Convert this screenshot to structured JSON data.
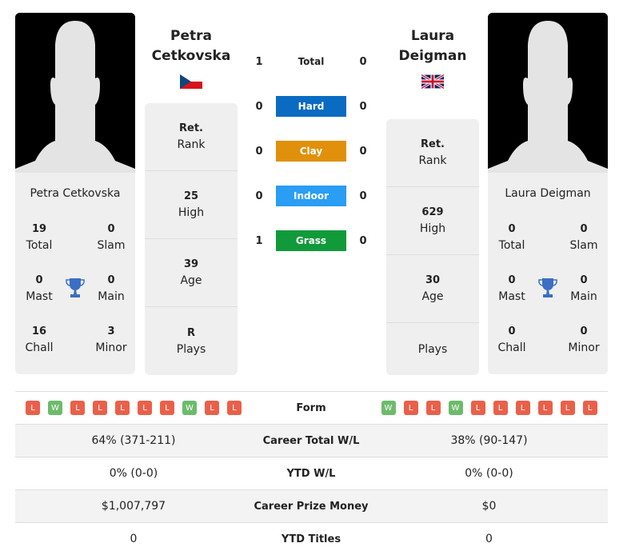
{
  "player1": {
    "name_line1": "Petra",
    "name_line2": "Cetkovska",
    "full_name": "Petra Cetkovska",
    "flag": "czech-republic-flag",
    "titles": {
      "total": "19",
      "slam": "0",
      "mast": "0",
      "main": "0",
      "chall": "16",
      "minor": "3"
    },
    "rank": {
      "value": "Ret.",
      "label": "Rank"
    },
    "high": {
      "value": "25",
      "label": "High"
    },
    "age": {
      "value": "39",
      "label": "Age"
    },
    "plays": {
      "value": "R",
      "label": "Plays"
    },
    "form": [
      "L",
      "W",
      "L",
      "L",
      "L",
      "L",
      "L",
      "W",
      "L",
      "L"
    ],
    "career_wl": "64% (371-211)",
    "ytd_wl": "0% (0-0)",
    "prize": "$1,007,797",
    "ytd_titles": "0"
  },
  "player2": {
    "name_line1": "Laura",
    "name_line2": "Deigman",
    "full_name": "Laura Deigman",
    "flag": "united-kingdom-flag",
    "titles": {
      "total": "0",
      "slam": "0",
      "mast": "0",
      "main": "0",
      "chall": "0",
      "minor": "0"
    },
    "rank": {
      "value": "Ret.",
      "label": "Rank"
    },
    "high": {
      "value": "629",
      "label": "High"
    },
    "age": {
      "value": "30",
      "label": "Age"
    },
    "plays": {
      "value": "",
      "label": "Plays"
    },
    "form": [
      "W",
      "L",
      "L",
      "W",
      "L",
      "L",
      "L",
      "L",
      "L",
      "L"
    ],
    "career_wl": "38% (90-147)",
    "ytd_wl": "0% (0-0)",
    "prize": "$0",
    "ytd_titles": "0"
  },
  "labels": {
    "total": "Total",
    "slam": "Slam",
    "mast": "Mast",
    "main": "Main",
    "chall": "Chall",
    "minor": "Minor"
  },
  "h2h": [
    {
      "label": "Total",
      "p1": "1",
      "p2": "0",
      "color": ""
    },
    {
      "label": "Hard",
      "p1": "0",
      "p2": "0",
      "color": "#0a6bc2"
    },
    {
      "label": "Clay",
      "p1": "0",
      "p2": "0",
      "color": "#e0900a"
    },
    {
      "label": "Indoor",
      "p1": "0",
      "p2": "0",
      "color": "#2a9df4"
    },
    {
      "label": "Grass",
      "p1": "1",
      "p2": "0",
      "color": "#109a3a"
    }
  ],
  "table": {
    "form": "Form",
    "career_wl": "Career Total W/L",
    "ytd_wl": "YTD W/L",
    "prize": "Career Prize Money",
    "ytd_titles": "YTD Titles"
  }
}
